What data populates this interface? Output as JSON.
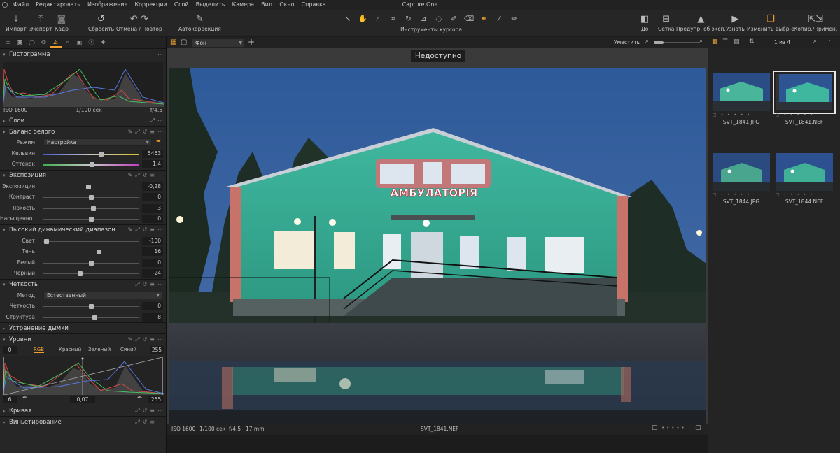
{
  "app": {
    "title": "Capture One"
  },
  "menu": [
    "Файл",
    "Редактировать",
    "Изображение",
    "Коррекции",
    "Слой",
    "Выделить",
    "Камера",
    "Вид",
    "Окно",
    "Справка"
  ],
  "toolbar": {
    "import": "Импорт",
    "export": "Экспорт",
    "capture": "Кадр",
    "reset": "Сбросить",
    "undo_redo": "Отмена / Повтор",
    "auto": "Автокоррекция",
    "cursor_tools": "Инструменты курсора",
    "before": "До",
    "grid": "Сетка",
    "exposure_warn": "Предупр. об эксп.",
    "learn": "Узнать",
    "edit_selected": "Изменить выбр-е",
    "copy_apply": "Копир./Примен."
  },
  "histogram": {
    "title": "Гистограмма",
    "iso": "ISO 1600",
    "shutter": "1/100 сек",
    "aperture": "f/4.5"
  },
  "layers": {
    "title": "Слои"
  },
  "white_balance": {
    "title": "Баланс белого",
    "mode_label": "Режим",
    "mode_value": "Настройка",
    "kelvin_label": "Кельвин",
    "kelvin_value": "5463",
    "kelvin_level": 0.6,
    "tint_label": "Оттенок",
    "tint_value": "1,4",
    "tint_level": 0.51
  },
  "exposure": {
    "title": "Экспозиция",
    "rows": [
      {
        "label": "Экспозиция",
        "value": "-0,28",
        "level": 0.47
      },
      {
        "label": "Контраст",
        "value": "0",
        "level": 0.5
      },
      {
        "label": "Яркость",
        "value": "3",
        "level": 0.52
      },
      {
        "label": "Насыщенно...",
        "value": "0",
        "level": 0.5
      }
    ]
  },
  "hdr": {
    "title": "Высокий динамический диапазон",
    "rows": [
      {
        "label": "Свет",
        "value": "-100",
        "level": 0.03
      },
      {
        "label": "Тень",
        "value": "16",
        "level": 0.58
      },
      {
        "label": "Белый",
        "value": "0",
        "level": 0.5
      },
      {
        "label": "Черный",
        "value": "-24",
        "level": 0.38
      }
    ]
  },
  "clarity": {
    "title": "Четкость",
    "method_label": "Метод",
    "method_value": "Естественный",
    "rows": [
      {
        "label": "Четкость",
        "value": "0",
        "level": 0.5
      },
      {
        "label": "Структура",
        "value": "8",
        "level": 0.54
      }
    ]
  },
  "dehaze": {
    "title": "Устранение дымки"
  },
  "levels": {
    "title": "Уровни",
    "in_low": "0",
    "in_high": "255",
    "tabs": [
      "RGB",
      "Красный",
      "Зеленый",
      "Синий"
    ],
    "out_low": "6",
    "mid": "0,07",
    "out_high": "255"
  },
  "curve": {
    "title": "Кривая"
  },
  "vignette": {
    "title": "Виньетирование"
  },
  "viewer": {
    "background_label": "Фон",
    "fit_label": "Уместить",
    "unavailable": "Недоступно",
    "iso": "ISO 1600",
    "shutter": "1/100 сек",
    "aperture": "f/4.5",
    "focal": "17 mm",
    "filename": "SVT_1841.NEF"
  },
  "photo_sign": "АМБУЛАТОРІЯ",
  "browser": {
    "count": "1 из 4",
    "items": [
      {
        "name": "SVT_1841.JPG"
      },
      {
        "name": "SVT_1841.NEF"
      },
      {
        "name": "SVT_1844.JPG"
      },
      {
        "name": "SVT_1844.NEF"
      }
    ]
  },
  "colors": {
    "accent": "#f0a030",
    "panel": "#262626",
    "background": "#1c1c1c"
  }
}
